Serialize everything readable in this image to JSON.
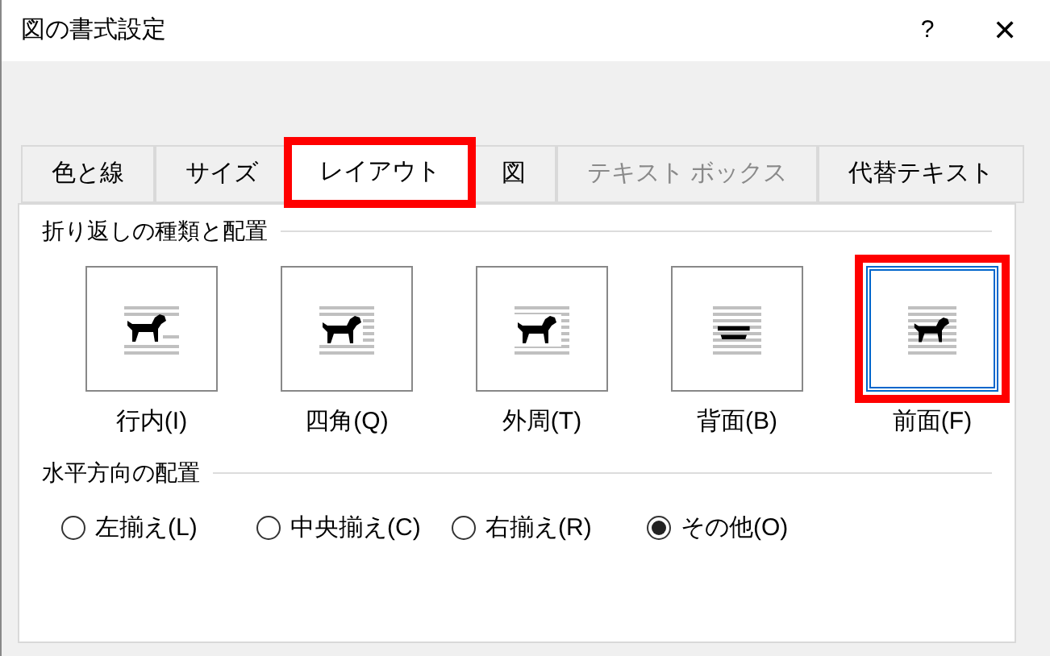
{
  "window": {
    "title": "図の書式設定",
    "help": "?",
    "close": "✕"
  },
  "tabs": [
    {
      "label": "色と線",
      "selected": false,
      "disabled": false,
      "highlighted": false
    },
    {
      "label": "サイズ",
      "selected": false,
      "disabled": false,
      "highlighted": false
    },
    {
      "label": "レイアウト",
      "selected": true,
      "disabled": false,
      "highlighted": true
    },
    {
      "label": "図",
      "selected": false,
      "disabled": false,
      "highlighted": false
    },
    {
      "label": "テキスト ボックス",
      "selected": false,
      "disabled": true,
      "highlighted": false
    },
    {
      "label": "代替テキスト",
      "selected": false,
      "disabled": false,
      "highlighted": false
    }
  ],
  "wrap_section": {
    "title": "折り返しの種類と配置",
    "options": [
      {
        "kind": "inline",
        "label": "行内(I)",
        "selected": false,
        "highlighted": false
      },
      {
        "kind": "square",
        "label": "四角(Q)",
        "selected": false,
        "highlighted": false
      },
      {
        "kind": "tight",
        "label": "外周(T)",
        "selected": false,
        "highlighted": false
      },
      {
        "kind": "behind",
        "label": "背面(B)",
        "selected": false,
        "highlighted": false
      },
      {
        "kind": "front",
        "label": "前面(F)",
        "selected": true,
        "highlighted": true
      }
    ]
  },
  "align_section": {
    "title": "水平方向の配置",
    "options": [
      {
        "label": "左揃え(L)",
        "selected": false
      },
      {
        "label": "中央揃え(C)",
        "selected": false
      },
      {
        "label": "右揃え(R)",
        "selected": false
      },
      {
        "label": "その他(O)",
        "selected": true
      }
    ]
  }
}
